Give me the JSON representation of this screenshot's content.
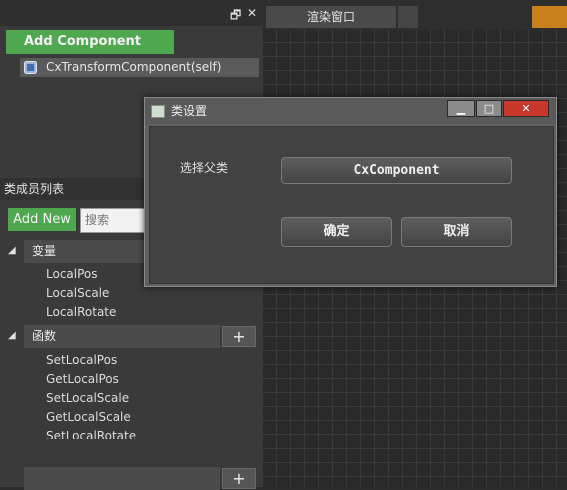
{
  "left_panel": {
    "add_component_label": "Add Component",
    "tree_item": "CxTransformComponent(self)",
    "restore_glyph": "🗗",
    "close_glyph": "✕"
  },
  "members": {
    "header": "类成员列表",
    "add_new": "Add New",
    "search_placeholder": "搜索",
    "groups": [
      {
        "name": "变量",
        "items": [
          "LocalPos",
          "LocalScale",
          "LocalRotate"
        ]
      },
      {
        "name": "函数",
        "items": [
          "SetLocalPos",
          "GetLocalPos",
          "SetLocalScale",
          "GetLocalScale",
          "SetLocalRotate"
        ]
      }
    ],
    "plus": "+"
  },
  "render": {
    "tab_label": "渲染窗口"
  },
  "dialog": {
    "title": "类设置",
    "parent_label": "选择父类",
    "parent_value": "CxComponent",
    "ok": "确定",
    "cancel": "取消",
    "min_glyph": "▁",
    "max_glyph": "□",
    "close_glyph": "✕"
  },
  "colors": {
    "accent_green": "#4fa84f",
    "close_red": "#c8372c",
    "orange_tab": "#c8801c"
  }
}
